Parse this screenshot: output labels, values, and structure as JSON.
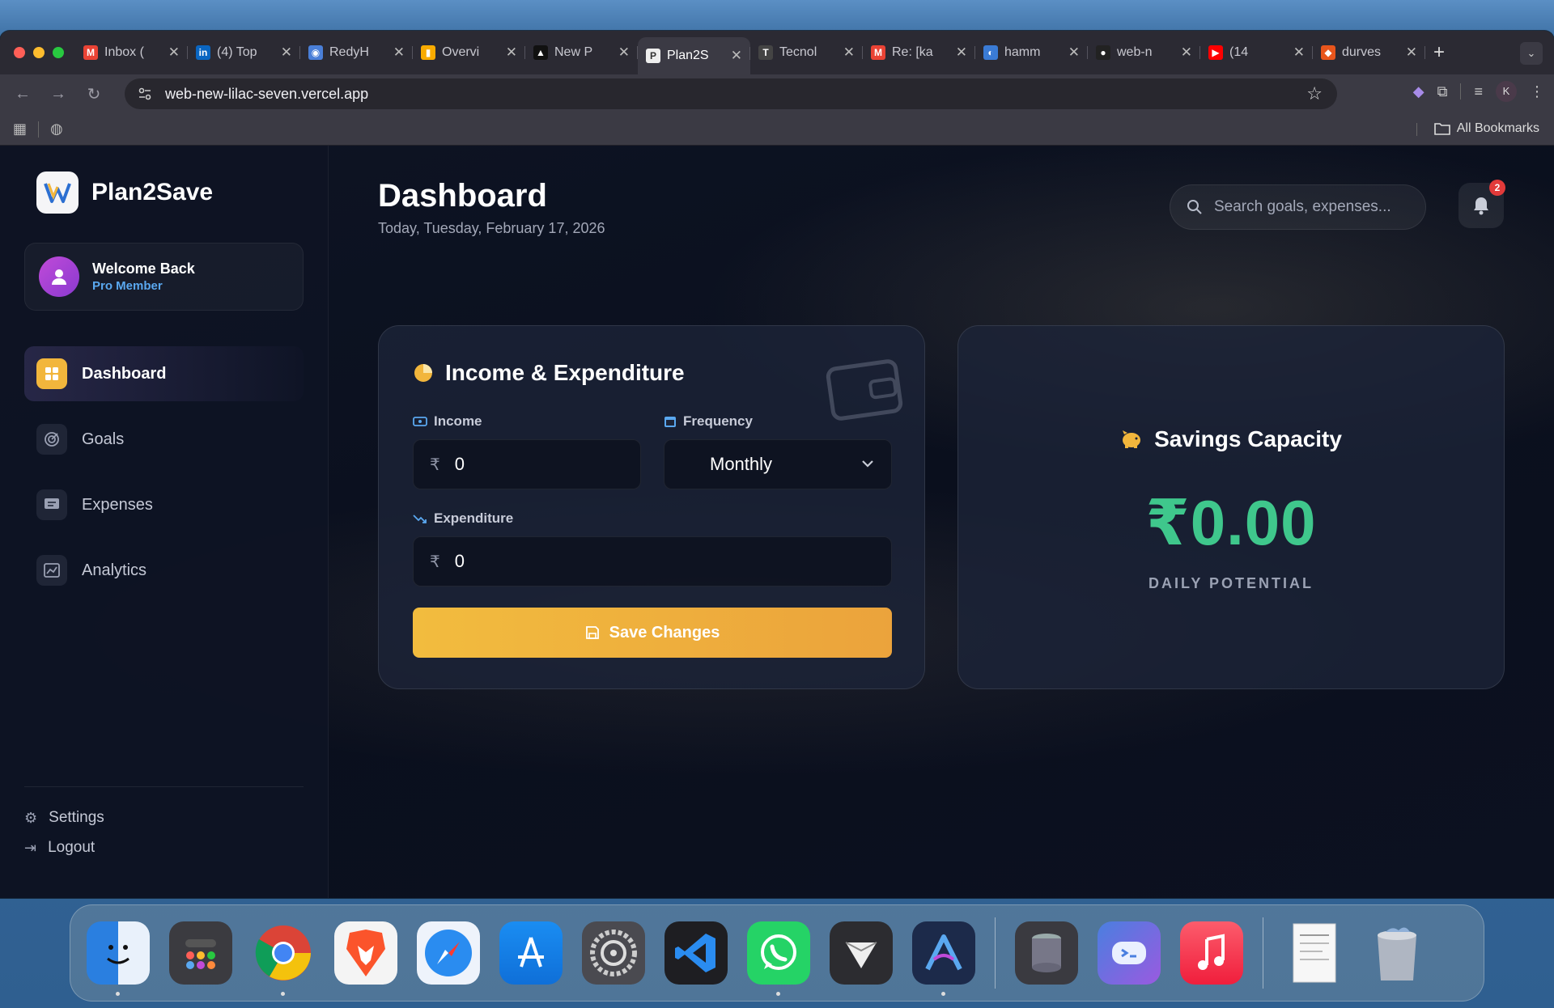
{
  "browser": {
    "tabs": [
      {
        "title": "Inbox (",
        "fav": "M",
        "color": "#ea4335",
        "active": false
      },
      {
        "title": "(4) Top",
        "fav": "in",
        "color": "#0a66c2",
        "active": false
      },
      {
        "title": "RedyH",
        "fav": "◉",
        "color": "#4a7fd8",
        "active": false
      },
      {
        "title": "Overvi",
        "fav": "▮",
        "color": "#f9ab00",
        "active": false
      },
      {
        "title": "New P",
        "fav": "▲",
        "color": "#111111",
        "active": false
      },
      {
        "title": "Plan2S",
        "fav": "P",
        "color": "#eeeeee",
        "active": true
      },
      {
        "title": "Tecnol",
        "fav": "T",
        "color": "#444444",
        "active": false
      },
      {
        "title": "Re: [ka",
        "fav": "M",
        "color": "#ea4335",
        "active": false
      },
      {
        "title": "hamm",
        "fav": "◐",
        "color": "#3a7bd5",
        "active": false
      },
      {
        "title": "web-n",
        "fav": "●",
        "color": "#222222",
        "active": false
      },
      {
        "title": "(14",
        "fav": "▶",
        "color": "#ff0000",
        "active": false
      },
      {
        "title": "durves",
        "fav": "◆",
        "color": "#e8551c",
        "active": false
      }
    ],
    "url": "web-new-lilac-seven.vercel.app",
    "profile_initial": "K",
    "all_bookmarks": "All Bookmarks"
  },
  "app": {
    "brand": "Plan2Save",
    "user": {
      "greeting": "Welcome Back",
      "tier": "Pro Member"
    },
    "nav": [
      {
        "label": "Dashboard",
        "icon": "grid-icon",
        "active": true
      },
      {
        "label": "Goals",
        "icon": "target-icon",
        "active": false
      },
      {
        "label": "Expenses",
        "icon": "receipt-icon",
        "active": false
      },
      {
        "label": "Analytics",
        "icon": "chart-icon",
        "active": false
      }
    ],
    "settings_label": "Settings",
    "logout_label": "Logout"
  },
  "header": {
    "title": "Dashboard",
    "date": "Today, Tuesday, February 17, 2026",
    "search_placeholder": "Search goals, expenses...",
    "notification_count": "2"
  },
  "income_card": {
    "title": "Income & Expenditure",
    "income_label": "Income",
    "income_value": "0",
    "frequency_label": "Frequency",
    "frequency_value": "Monthly",
    "expenditure_label": "Expenditure",
    "expenditure_value": "0",
    "currency": "₹",
    "save_label": "Save Changes"
  },
  "savings_card": {
    "title": "Savings Capacity",
    "amount": "₹0.00",
    "label": "DAILY POTENTIAL"
  },
  "dock": [
    "finder",
    "launchpad",
    "chrome",
    "brave",
    "safari",
    "app-store",
    "system-settings",
    "vscode",
    "whatsapp",
    "plasticity",
    "arc",
    "disk",
    "copilot",
    "music",
    "document",
    "trash"
  ],
  "colors": {
    "accent": "#f2b63c",
    "positive": "#3fc78c",
    "link": "#5aa8f0"
  }
}
